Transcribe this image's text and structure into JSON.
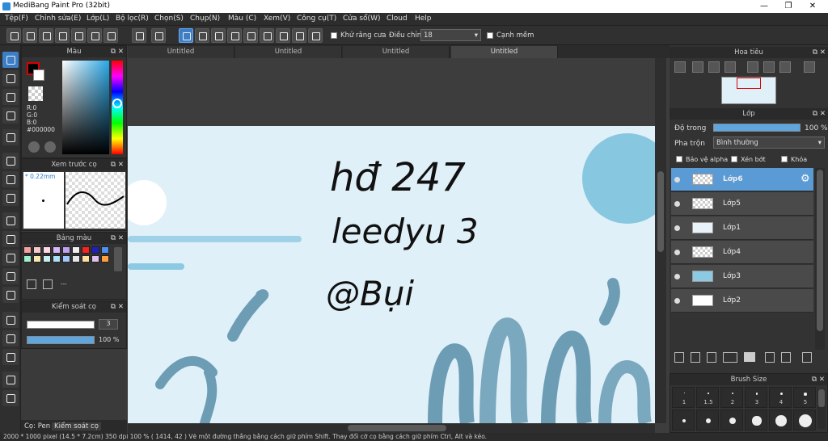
{
  "window": {
    "title": "MediBang Paint Pro (32bit)",
    "minimize": "—",
    "maximize": "❐",
    "close": "✕"
  },
  "menu": [
    "Tệp(F)",
    "Chỉnh sửa(E)",
    "Lớp(L)",
    "Bộ lọc(R)",
    "Chọn(S)",
    "Chụp(N)",
    "Màu (C)",
    "Xem(V)",
    "Công cụ(T)",
    "Cửa sổ(W)",
    "Cloud",
    "Help"
  ],
  "toolbar": {
    "antialias_label": "Khử răng cưa",
    "adjust_label": "Điều chỉnh",
    "adjust_value": "18",
    "smooth_label": "Cạnh mềm",
    "dropdown_glyph": "▾"
  },
  "colorpanel": {
    "title": "Màu",
    "r": "R:0",
    "g": "G:0",
    "b": "B:0",
    "hex": "#000000",
    "accent": "#3d7fc7"
  },
  "brushpreview": {
    "title": "Xem trước cọ",
    "size": "0.22mm"
  },
  "palette": {
    "title": "Bảng màu",
    "dashes": "---"
  },
  "brushcontrol": {
    "title": "Kiểm soát cọ",
    "size_value": "3",
    "opacity_value": "100 %"
  },
  "bottomtabs": {
    "pen": "Cọ: Pen",
    "control": "Kiểm soát cọ"
  },
  "tabs": [
    "Untitled",
    "Untitled",
    "Untitled",
    "Untitled"
  ],
  "canvas_text": [
    "hđ 247",
    "leedyu 3",
    "@Bụi"
  ],
  "navigator": {
    "title": "Hoa tiêu"
  },
  "layers": {
    "title": "Lớp",
    "opacity_label": "Độ trong",
    "opacity_value": "100 %",
    "opacity_fraction": 1.0,
    "blend_label": "Pha trộn",
    "blend_value": "Bình thường",
    "protect_alpha": "Bảo vệ alpha",
    "clip": "Xén bớt",
    "lock": "Khóa",
    "items": [
      {
        "name": "Lớp6",
        "active": true
      },
      {
        "name": "Lớp5",
        "active": false
      },
      {
        "name": "Lớp1",
        "active": false
      },
      {
        "name": "Lớp4",
        "active": false
      },
      {
        "name": "Lớp3",
        "active": false
      },
      {
        "name": "Lớp2",
        "active": false
      }
    ]
  },
  "brushsize": {
    "title": "Brush Size",
    "labels": [
      "1",
      "1.5",
      "2",
      "3",
      "4",
      "5"
    ]
  },
  "status": "2000 * 1000 pixel   (14.5 * 7.2cm)   350 dpi   100 %   ( 1414, 42 )   Vẽ một đường thẳng bằng cách giữ phím Shift. Thay đổi cỡ cọ bằng cách giữ phím Ctrl, Alt và kéo."
}
